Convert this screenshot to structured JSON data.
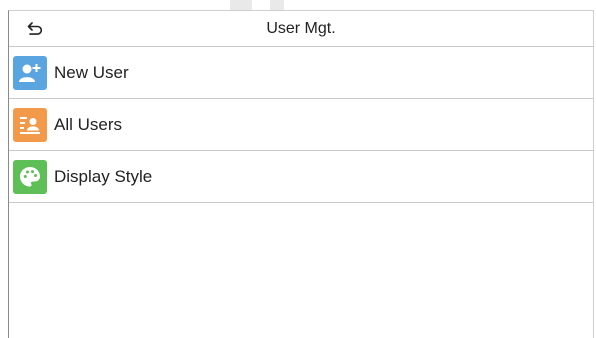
{
  "header": {
    "title": "User Mgt.",
    "back_icon": "back-arrow-icon"
  },
  "menu": {
    "items": [
      {
        "label": "New User",
        "icon": "add-user-icon",
        "color": "#5aa5e0"
      },
      {
        "label": "All Users",
        "icon": "user-list-icon",
        "color": "#f39a4a"
      },
      {
        "label": "Display Style",
        "icon": "palette-icon",
        "color": "#5fbf57"
      }
    ]
  }
}
